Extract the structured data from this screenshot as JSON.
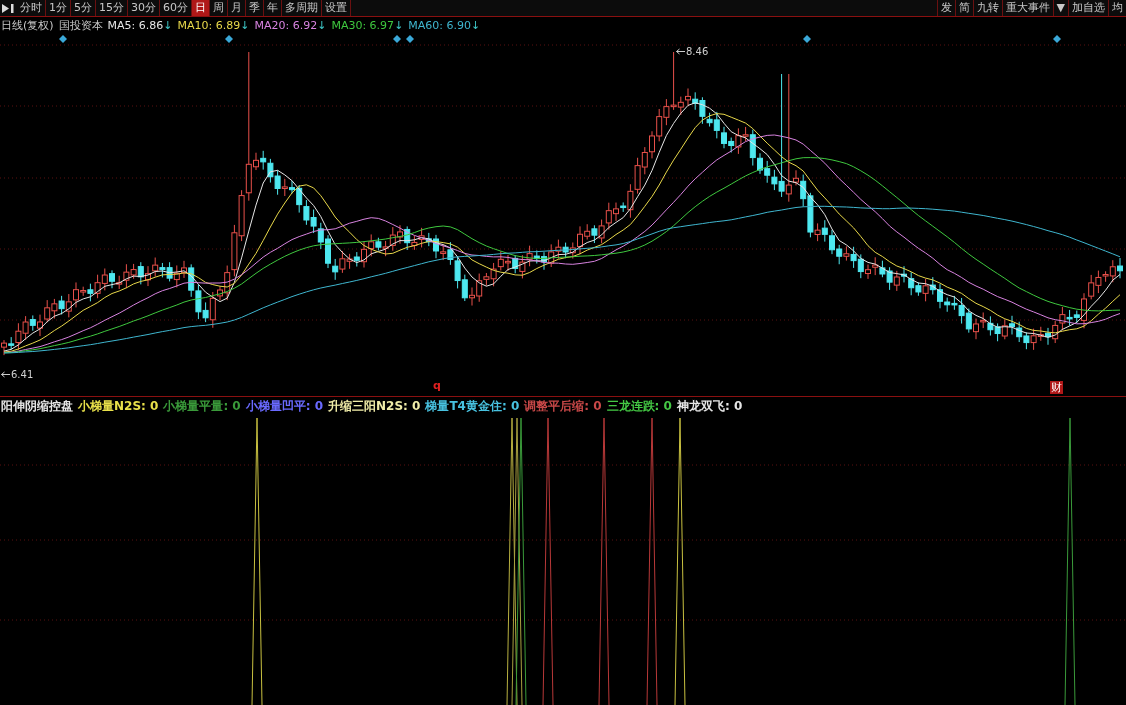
{
  "toolbar": {
    "left": [
      {
        "label": "分时",
        "selected": false
      },
      {
        "label": "1分",
        "selected": false
      },
      {
        "label": "5分",
        "selected": false
      },
      {
        "label": "15分",
        "selected": false
      },
      {
        "label": "30分",
        "selected": false
      },
      {
        "label": "60分",
        "selected": false
      },
      {
        "label": "日",
        "selected": true
      },
      {
        "label": "周",
        "selected": false
      },
      {
        "label": "月",
        "selected": false
      },
      {
        "label": "季",
        "selected": false
      },
      {
        "label": "年",
        "selected": false
      },
      {
        "label": "多周期",
        "selected": false
      },
      {
        "label": "设置",
        "selected": false
      }
    ],
    "right": [
      {
        "label": "发"
      },
      {
        "label": "简"
      },
      {
        "label": "九转"
      },
      {
        "label": "重大事件"
      },
      {
        "label": "▼"
      },
      {
        "label": "加自选"
      },
      {
        "label": "均"
      }
    ]
  },
  "legend": {
    "period": "日线(复权)",
    "stock": "国投资本",
    "averages": [
      {
        "label": "MA5: 6.86",
        "arrow": "↓",
        "color": "#e6e6e6"
      },
      {
        "label": "MA10: 6.89",
        "arrow": "↓",
        "color": "#e8d84a"
      },
      {
        "label": "MA20: 6.92",
        "arrow": "↓",
        "color": "#d883e0"
      },
      {
        "label": "MA30: 6.97",
        "arrow": "↓",
        "color": "#3fc83f"
      },
      {
        "label": "MA60: 6.90",
        "arrow": "↓",
        "color": "#3fb6cf"
      }
    ]
  },
  "price_chart": {
    "high_label": "8.46",
    "low_label": "6.41",
    "markers": [
      {
        "text": "q",
        "kind": "letter"
      },
      {
        "text": "财",
        "kind": "badge"
      }
    ]
  },
  "indicator": {
    "items": [
      {
        "label": "阳伸阴缩控盘",
        "color": "#e6e6e6"
      },
      {
        "label": "小梯量N2S: 0",
        "color": "#e8e04a"
      },
      {
        "label": "小梯量平量: 0",
        "color": "#3a9a3a"
      },
      {
        "label": "小梯量凹平: 0",
        "color": "#6a6aff"
      },
      {
        "label": "升缩三阳N2S: 0",
        "color": "#f0eca8"
      },
      {
        "label": "梯量T4黄金住: 0",
        "color": "#48c2e0"
      },
      {
        "label": "调整平后缩: 0",
        "color": "#c84848"
      },
      {
        "label": "三龙连跌: 0",
        "color": "#44c844"
      },
      {
        "label": "神龙双飞: 0",
        "color": "#e6e6e6"
      }
    ]
  }
}
